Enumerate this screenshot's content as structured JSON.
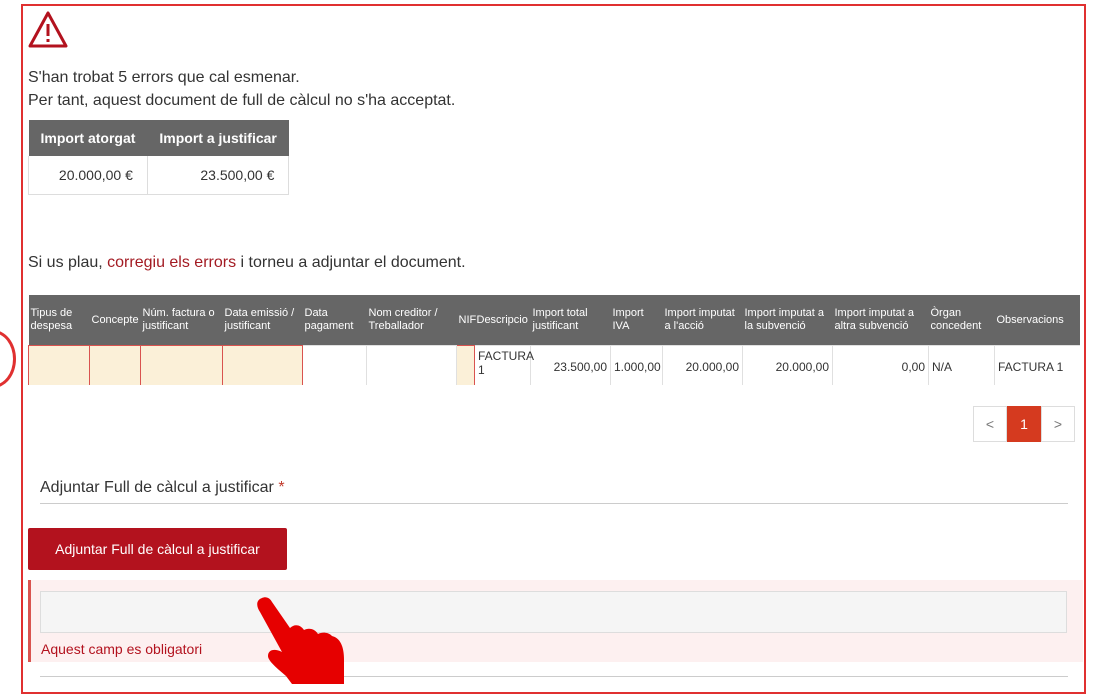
{
  "alert": {
    "icon": "warning-triangle-icon",
    "line1": "S'han trobat 5 errors que cal esmenar.",
    "line2": "Per tant, aquest document de full de càlcul no s'ha acceptat."
  },
  "amounts": {
    "headers": [
      "Import atorgat",
      "Import a justificar"
    ],
    "values": [
      "20.000,00 €",
      "23.500,00 €"
    ]
  },
  "instruction": {
    "before": "Si us plau, ",
    "link": "corregiu els errors",
    "after": " i torneu a adjuntar el document."
  },
  "grid": {
    "headers": [
      "Tipus de despesa",
      "Concepte",
      "Núm. factura o justificant",
      "Data emissió / justificant",
      "Data pagament",
      "Nom creditor / Treballador",
      "NIF",
      "Descripcio",
      "Import total justificant",
      "Import IVA",
      "Import imputat a l'acció",
      "Import imputat a la subvenció",
      "Import imputat a altra subvenció",
      "Òrgan concedent",
      "Observacions"
    ],
    "row": [
      "",
      "",
      "",
      "",
      "",
      "",
      "",
      "FACTURA 1",
      "23.500,00",
      "1.000,00",
      "20.000,00",
      "20.000,00",
      "0,00",
      "N/A",
      "FACTURA 1"
    ]
  },
  "pagination": {
    "prev": "<",
    "current": "1",
    "next": ">"
  },
  "upload": {
    "label": "Adjuntar Full de càlcul a justificar",
    "required_mark": "*",
    "button": "Adjuntar Full de càlcul a justificar",
    "error": "Aquest camp es obligatori"
  },
  "colors": {
    "accent": "#b3121e",
    "error_border": "#e03030",
    "header_bg": "#666666"
  }
}
